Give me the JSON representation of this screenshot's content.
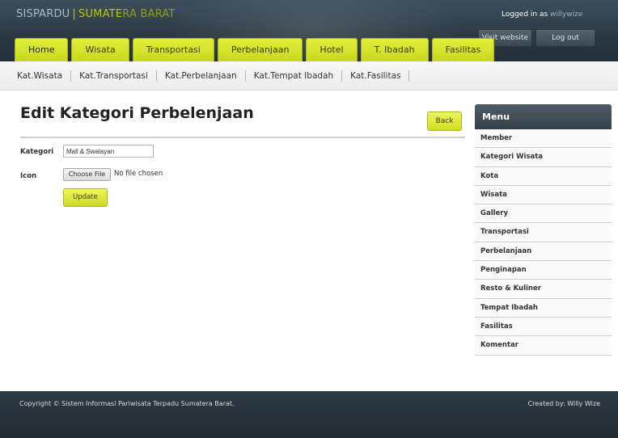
{
  "header": {
    "brand_part1": "SISPARDU",
    "brand_separator": "|",
    "brand_part2": "SUMATE",
    "brand_part3": "RA BARAT",
    "logged_in_prefix": "Logged in as",
    "username": "willywize",
    "visit_website": "Visit website",
    "log_out": "Log out"
  },
  "nav": {
    "tabs": [
      "Home",
      "Wisata",
      "Transportasi",
      "Perbelanjaan",
      "Hotel",
      "T. Ibadah",
      "Fasilitas"
    ]
  },
  "subnav": {
    "items": [
      "Kat.Wisata",
      "Kat.Transportasi",
      "Kat.Perbelanjaan",
      "Kat.Tempat Ibadah",
      "Kat.Fasilitas"
    ]
  },
  "main": {
    "title": "Edit Kategori Perbelenjaan",
    "back_label": "Back",
    "kategori_label": "Kategori",
    "kategori_value": "Mall & Swalayan",
    "icon_label": "Icon",
    "choose_file_label": "Choose File",
    "file_status": "No file chosen",
    "update_label": "Update"
  },
  "menu": {
    "title": "Menu",
    "items": [
      "Member",
      "Kategori Wisata",
      "Kota",
      "Wisata",
      "Gallery",
      "Transportasi",
      "Perbelanjaan",
      "Penginapan",
      "Resto & Kuliner",
      "Tempat Ibadah",
      "Fasilitas",
      "Komentar"
    ]
  },
  "footer": {
    "copyright": "Copyright © Sistem Informasi Pariwisata Terpadu Sumatera Barat.",
    "created_by": "Created by: Willy Wize"
  },
  "colors": {
    "accent": "#cfdd22",
    "header": "#2b3843",
    "footer": "#212b33"
  }
}
